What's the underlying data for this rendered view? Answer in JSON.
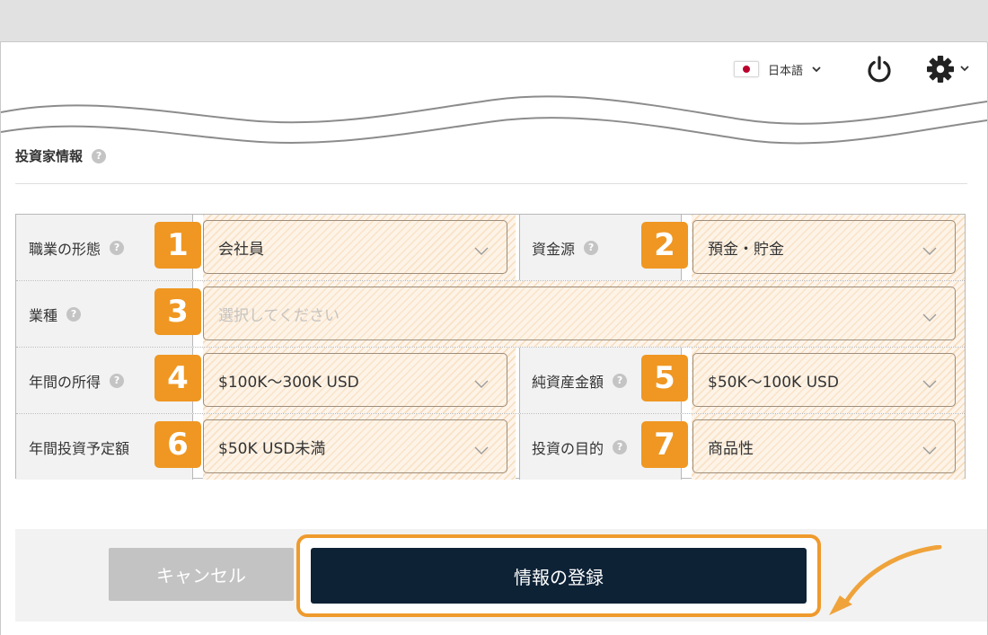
{
  "header": {
    "language": "日本語",
    "icons": [
      "japan-flag-icon",
      "chevron-down-icon",
      "power-icon",
      "gear-icon"
    ]
  },
  "section": {
    "title": "投資家情報"
  },
  "form": {
    "fields": [
      {
        "label": "職業の形態",
        "value": "会社員",
        "badge": "1"
      },
      {
        "label": "資金源",
        "value": "預金・貯金",
        "badge": "2"
      },
      {
        "label": "業種",
        "placeholder": "選択してください",
        "badge": "3"
      },
      {
        "label": "年間の所得",
        "value": "$100K～300K USD",
        "badge": "4"
      },
      {
        "label": "純資産金額",
        "value": "$50K～100K USD",
        "badge": "5"
      },
      {
        "label": "年間投資予定額",
        "value": "$50K USD未満",
        "badge": "6"
      },
      {
        "label": "投資の目的",
        "value": "商品性",
        "badge": "7"
      }
    ]
  },
  "footer": {
    "cancel_label": "キャンセル",
    "submit_label": "情報の登録"
  },
  "colors": {
    "badge": "#ef9722",
    "submit_bg": "#0e2236",
    "highlight": "#ef9a2d",
    "cancel_bg": "#c3c3c3"
  }
}
